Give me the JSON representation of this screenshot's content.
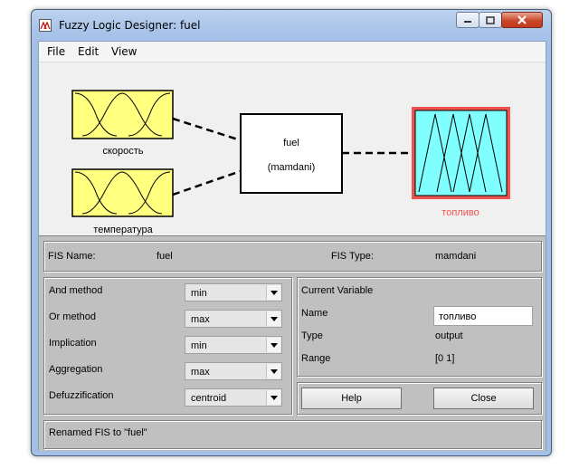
{
  "window": {
    "title": "Fuzzy Logic Designer: fuel"
  },
  "menu": {
    "items": [
      "File",
      "Edit",
      "View"
    ]
  },
  "diagram": {
    "inputs": [
      {
        "label": "скорость"
      },
      {
        "label": "температура"
      }
    ],
    "system": {
      "name": "fuel",
      "type": "(mamdani)"
    },
    "output": {
      "label": "топливо"
    },
    "colors": {
      "input_fill": "#ffff80",
      "output_fill": "#80ffff",
      "selected_border": "#ef5350",
      "selected_label": "#ef5350"
    }
  },
  "fis_info": {
    "name_label": "FIS Name:",
    "name_value": "fuel",
    "type_label": "FIS Type:",
    "type_value": "mamdani"
  },
  "methods": [
    {
      "label": "And method",
      "value": "min"
    },
    {
      "label": "Or method",
      "value": "max"
    },
    {
      "label": "Implication",
      "value": "min"
    },
    {
      "label": "Aggregation",
      "value": "max"
    },
    {
      "label": "Defuzzification",
      "value": "centroid"
    }
  ],
  "current_variable": {
    "header": "Current Variable",
    "name_label": "Name",
    "name_value": "топливо",
    "type_label": "Type",
    "type_value": "output",
    "range_label": "Range",
    "range_value": "[0 1]"
  },
  "buttons": {
    "help": "Help",
    "close": "Close"
  },
  "status": {
    "text": "Renamed FIS to \"fuel\""
  }
}
